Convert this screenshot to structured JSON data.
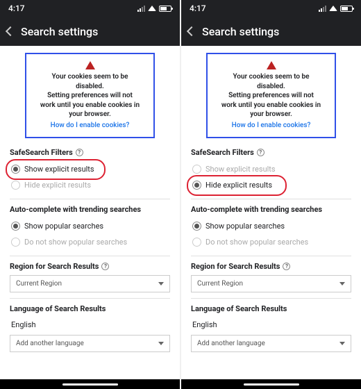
{
  "status": {
    "time": "4:17"
  },
  "appbar": {
    "title": "Search settings"
  },
  "cookie_notice": {
    "line1": "Your cookies seem to be disabled.",
    "line2": "Setting preferences will not work until you enable cookies in your browser.",
    "link": "How do I enable cookies?"
  },
  "safesearch": {
    "title": "SafeSearch Filters",
    "options": {
      "show": "Show explicit results",
      "hide": "Hide explicit results"
    }
  },
  "autocomplete": {
    "title": "Auto-complete with trending searches",
    "options": {
      "show": "Show popular searches",
      "hide": "Do not show popular searches"
    }
  },
  "region": {
    "title": "Region for Search Results",
    "value": "Current Region"
  },
  "language": {
    "title": "Language of Search Results",
    "current": "English",
    "add_placeholder": "Add another language"
  },
  "panes": {
    "left": {
      "safesearch_selected": "show"
    },
    "right": {
      "safesearch_selected": "hide"
    }
  }
}
